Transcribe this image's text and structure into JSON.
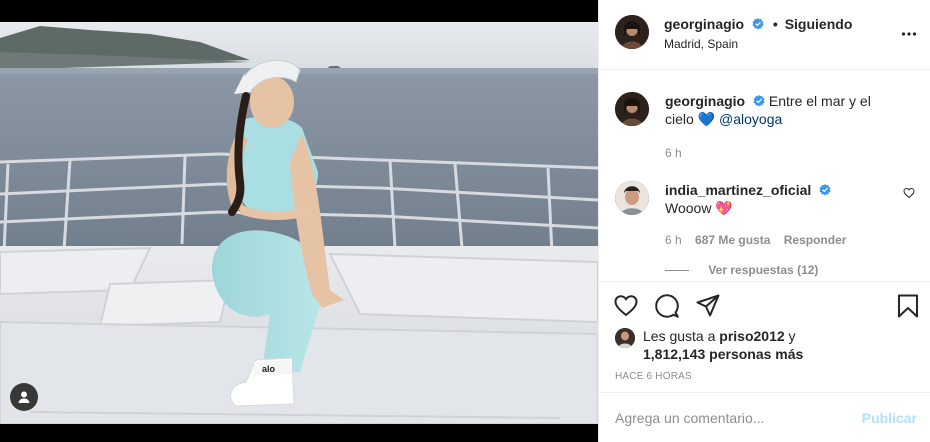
{
  "post": {
    "username": "georginagio",
    "follow_status": "Siguiendo",
    "location": "Madrid, Spain"
  },
  "caption": {
    "username": "georginagio",
    "text": "Entre el mar y el cielo",
    "emoji": "💙",
    "mention": "@aloyoga",
    "time": "6 h"
  },
  "comments": [
    {
      "username": "india_martinez_oficial",
      "text": "Wooow",
      "emoji": "💖",
      "time": "6 h",
      "likes": "687 Me gusta",
      "reply_label": "Responder",
      "view_replies": "Ver respuestas (12)"
    }
  ],
  "likes": {
    "prefix": "Les gusta a",
    "user": "priso2012",
    "connector": "y",
    "others": "1,812,143 personas más"
  },
  "timestamp": "HACE 6 HORAS",
  "comment_box": {
    "placeholder": "Agrega un comentario...",
    "post_label": "Publicar"
  },
  "icons": {
    "verified": "verified-badge-icon",
    "more": "more-options-icon",
    "like": "heart-icon",
    "comment": "comment-icon",
    "share": "paper-plane-icon",
    "save": "bookmark-icon",
    "tag": "user-tag-icon"
  },
  "colors": {
    "verified": "#3897f0",
    "link": "#00376b",
    "muted": "#8e8e8e",
    "post_disabled": "#b2dffc"
  }
}
